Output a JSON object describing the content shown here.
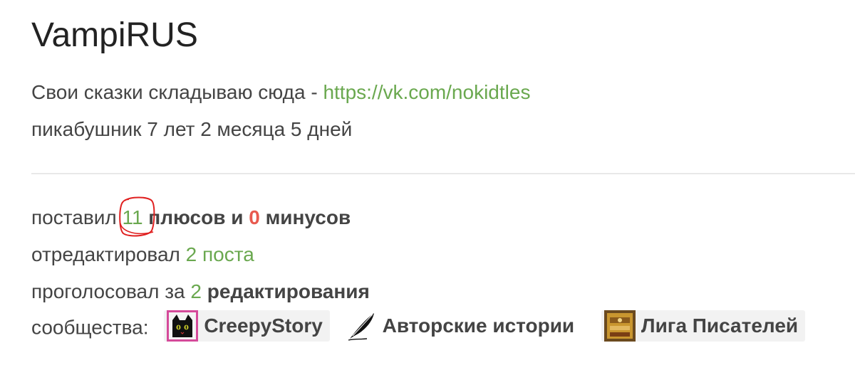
{
  "profile": {
    "username": "VampiRUS",
    "about_prefix": "Свои сказки складываю сюда - ",
    "about_link": "https://vk.com/nokidtles",
    "age_text": "пикабушник 7 лет 2 месяца 5 дней"
  },
  "stats": {
    "votes_prefix": "поставил ",
    "plus_count": "11",
    "plus_word": " плюсов и ",
    "minus_count": "0",
    "minus_word": " минусов",
    "edited_prefix": "отредактировал ",
    "edited_value": "2 поста",
    "voted_prefix": "проголосовал за ",
    "voted_count": "2",
    "voted_word": " редактирования"
  },
  "communities": {
    "label": "сообщества:",
    "items": [
      {
        "name": "CreepyStory",
        "icon": "black-cat-icon"
      },
      {
        "name": "Авторские истории",
        "icon": "quill-pen-icon"
      },
      {
        "name": "Лига Писателей",
        "icon": "writers-league-icon"
      }
    ]
  },
  "colors": {
    "link": "#6aa84f",
    "positive": "#6aa84f",
    "negative": "#e85a4f",
    "annotation": "#e02020"
  }
}
